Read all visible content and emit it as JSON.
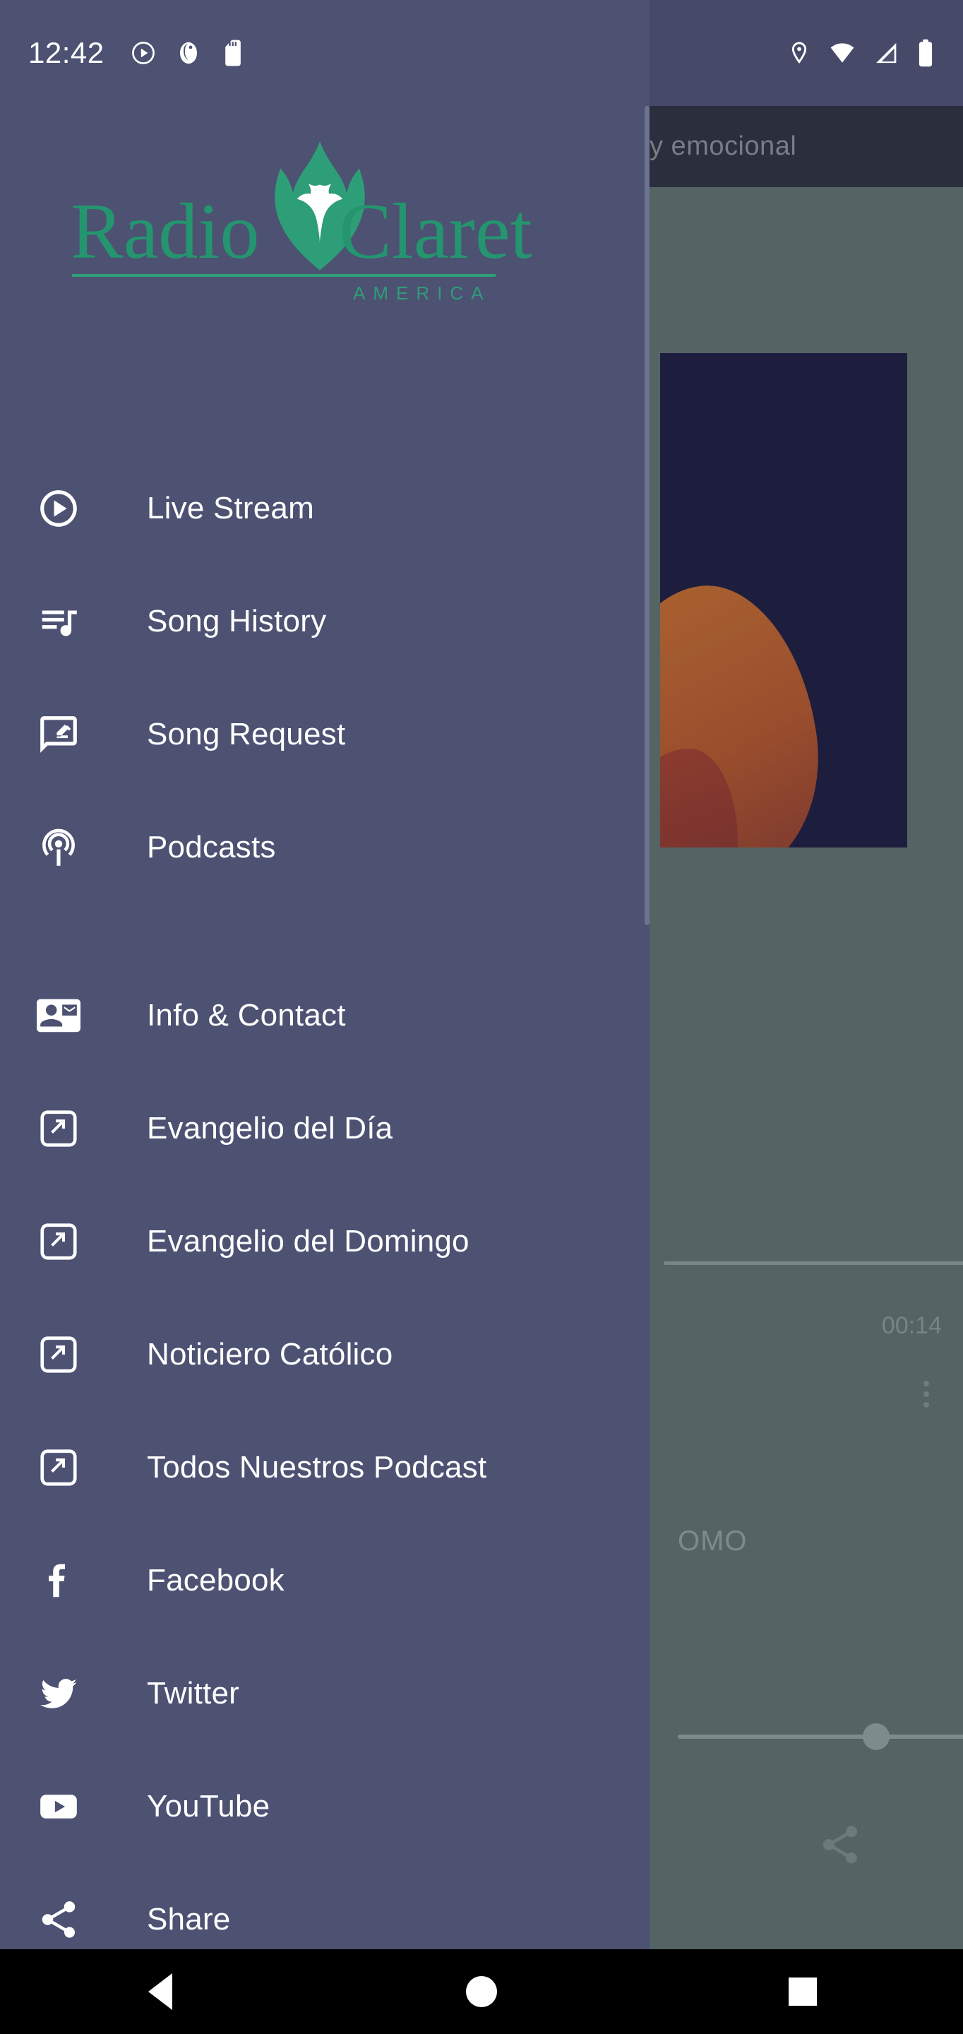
{
  "status_bar": {
    "clock": "12:42",
    "left_icons": [
      "play-circle-icon",
      "contrast-icon",
      "sd-card-icon"
    ],
    "right_icons": [
      "location-pin-icon",
      "wifi-icon",
      "cellular-signal-icon",
      "battery-icon"
    ]
  },
  "drawer": {
    "logo": {
      "word1": "Radio",
      "word2": "Claret",
      "subtitle": "AMERICA",
      "emblem": "flame-dove-icon",
      "brand_color": "#2e9e78"
    },
    "group1": [
      {
        "label": "Live Stream",
        "icon": "play-circle-outline-icon"
      },
      {
        "label": "Song History",
        "icon": "queue-music-icon"
      },
      {
        "label": "Song Request",
        "icon": "rate-review-icon"
      },
      {
        "label": "Podcasts",
        "icon": "podcast-broadcast-icon"
      }
    ],
    "group2": [
      {
        "label": "Info & Contact",
        "icon": "contact-mail-icon"
      },
      {
        "label": "Evangelio del Día",
        "icon": "open-in-new-icon"
      },
      {
        "label": "Evangelio del Domingo",
        "icon": "open-in-new-icon"
      },
      {
        "label": "Noticiero Católico",
        "icon": "open-in-new-icon"
      },
      {
        "label": "Todos Nuestros Podcast",
        "icon": "open-in-new-icon"
      },
      {
        "label": "Facebook",
        "icon": "facebook-icon"
      },
      {
        "label": "Twitter",
        "icon": "twitter-icon"
      },
      {
        "label": "YouTube",
        "icon": "youtube-icon"
      },
      {
        "label": "Share",
        "icon": "share-icon"
      }
    ]
  },
  "background": {
    "app_bar_title": "y emocional",
    "elapsed_time": "00:14",
    "track_title": "OMO",
    "share_icon": "share-icon",
    "overflow_icon": "more-vert-icon"
  },
  "nav_bar": {
    "back": "back-triangle-icon",
    "home": "home-circle-icon",
    "recents": "recents-square-icon"
  },
  "colors": {
    "drawer_bg": "#4d5172",
    "brand_green": "#2e9e78",
    "text_primary": "#ffffff"
  }
}
